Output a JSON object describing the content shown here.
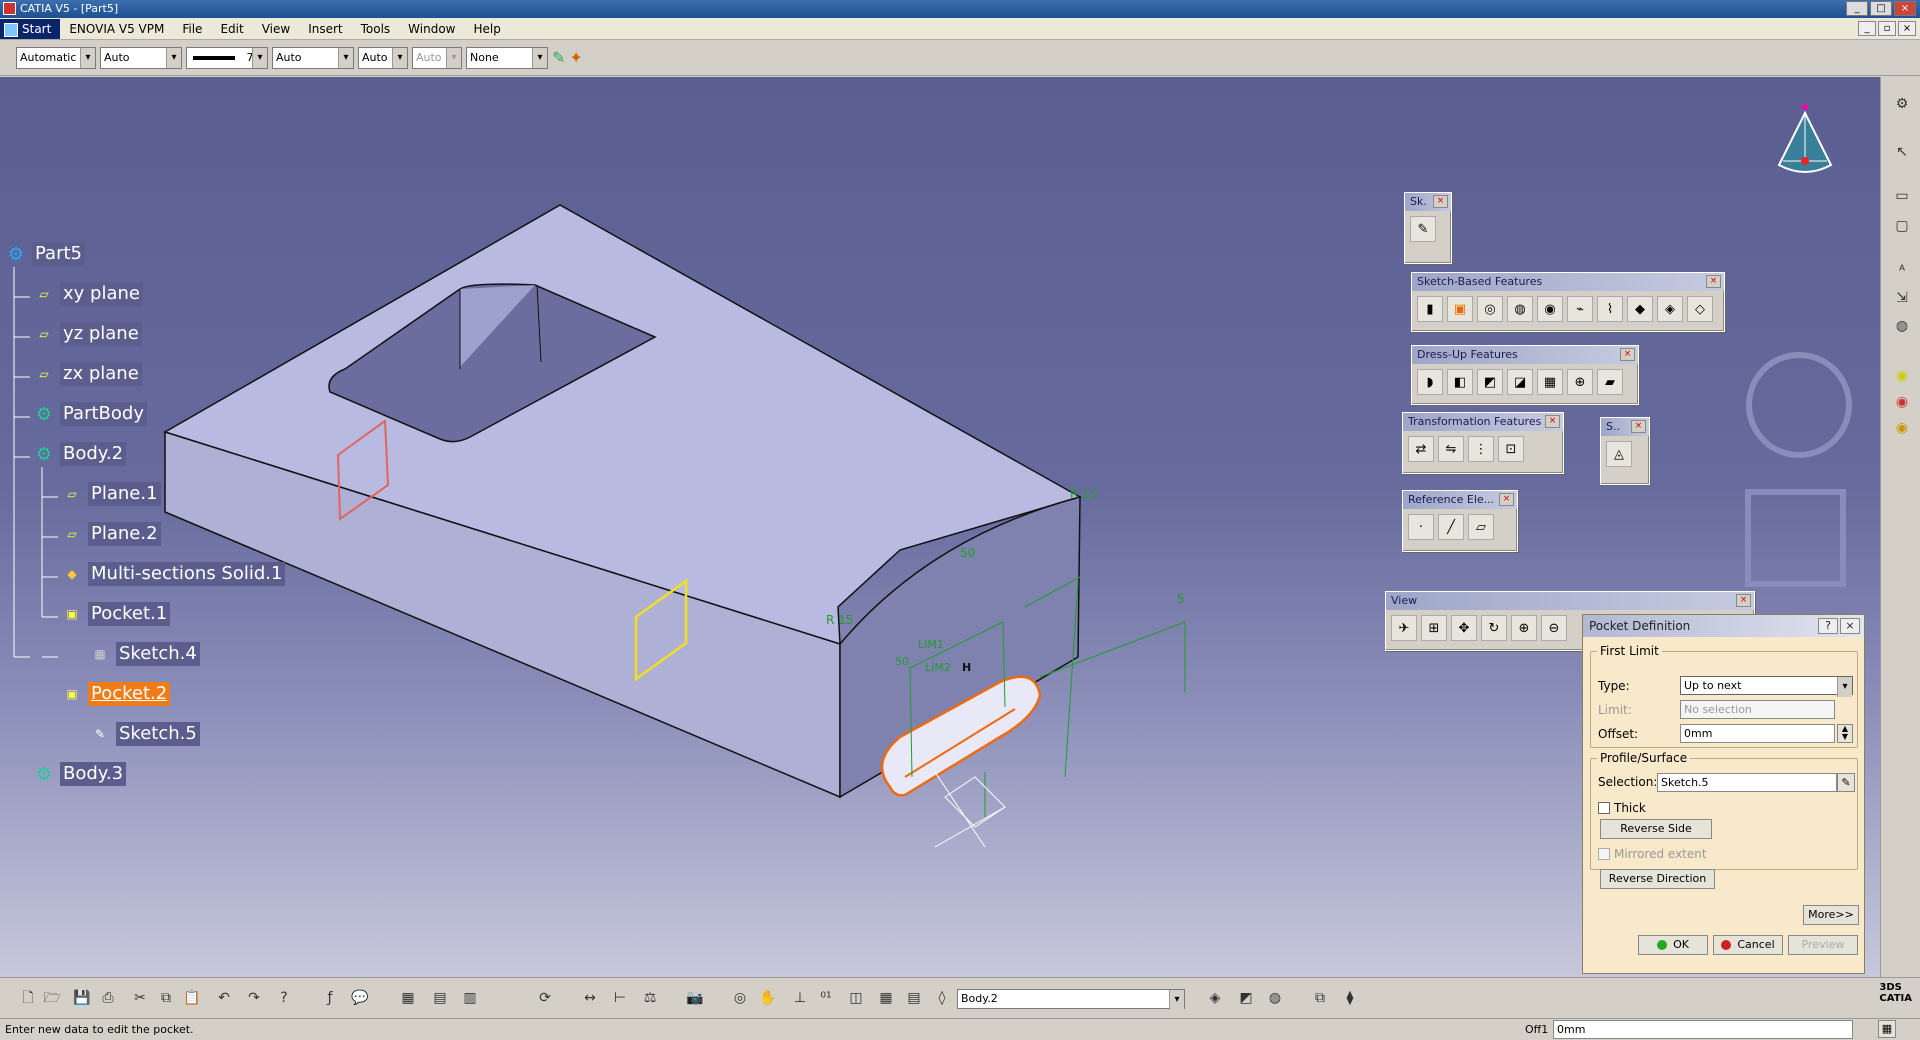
{
  "window": {
    "title": "CATIA V5 - [Part5]"
  },
  "menu": [
    "Start",
    "ENOVIA V5 VPM",
    "File",
    "Edit",
    "View",
    "Insert",
    "Tools",
    "Window",
    "Help"
  ],
  "propbar": {
    "combo1": "Automatic",
    "combo2": "Auto",
    "linewidth": "7",
    "combo4": "Auto",
    "combo5": "Auto",
    "combo6": "Auto",
    "combo7": "None"
  },
  "tree": {
    "root": "Part5",
    "xy": "xy plane",
    "yz": "yz plane",
    "zx": "zx plane",
    "partbody": "PartBody",
    "body2": "Body.2",
    "plane1": "Plane.1",
    "plane2": "Plane.2",
    "ms": "Multi-sections Solid.1",
    "pocket1": "Pocket.1",
    "sketch4": "Sketch.4",
    "pocket2": "Pocket.2",
    "sketch5": "Sketch.5",
    "body3": "Body.3"
  },
  "annotations": {
    "r15a": "R 15",
    "r15b": "R 15",
    "d50": "50",
    "d5": "5",
    "d50b": "50",
    "lim1": "LIM1",
    "lim2": "LIM2",
    "h": "H"
  },
  "toolbars": {
    "sk": "Sk.",
    "sbf": "Sketch-Based Features",
    "duf": "Dress-Up Features",
    "tf": "Transformation Features",
    "s": "S..",
    "ref": "Reference Ele...",
    "view": "View"
  },
  "dialog": {
    "title": "Pocket Definition",
    "first_limit": "First Limit",
    "type_label": "Type:",
    "type_value": "Up to next",
    "limit_label": "Limit:",
    "limit_value": "No selection",
    "offset_label": "Offset:",
    "offset_value": "0mm",
    "profile": "Profile/Surface",
    "selection_label": "Selection:",
    "selection_value": "Sketch.5",
    "thick": "Thick",
    "reverse_side": "Reverse Side",
    "mirrored": "Mirrored extent",
    "reverse_direction": "Reverse Direction",
    "more": "More>>",
    "ok": "OK",
    "cancel": "Cancel",
    "preview": "Preview"
  },
  "bottom": {
    "current_body": "Body.2"
  },
  "status": {
    "message": "Enter new data to edit the pocket.",
    "field_label": "Off1",
    "field_value": "0mm"
  },
  "colors": {
    "viewport_top": "#5a5e91",
    "selection": "#f07c17",
    "dim": "#1f9e2a"
  }
}
